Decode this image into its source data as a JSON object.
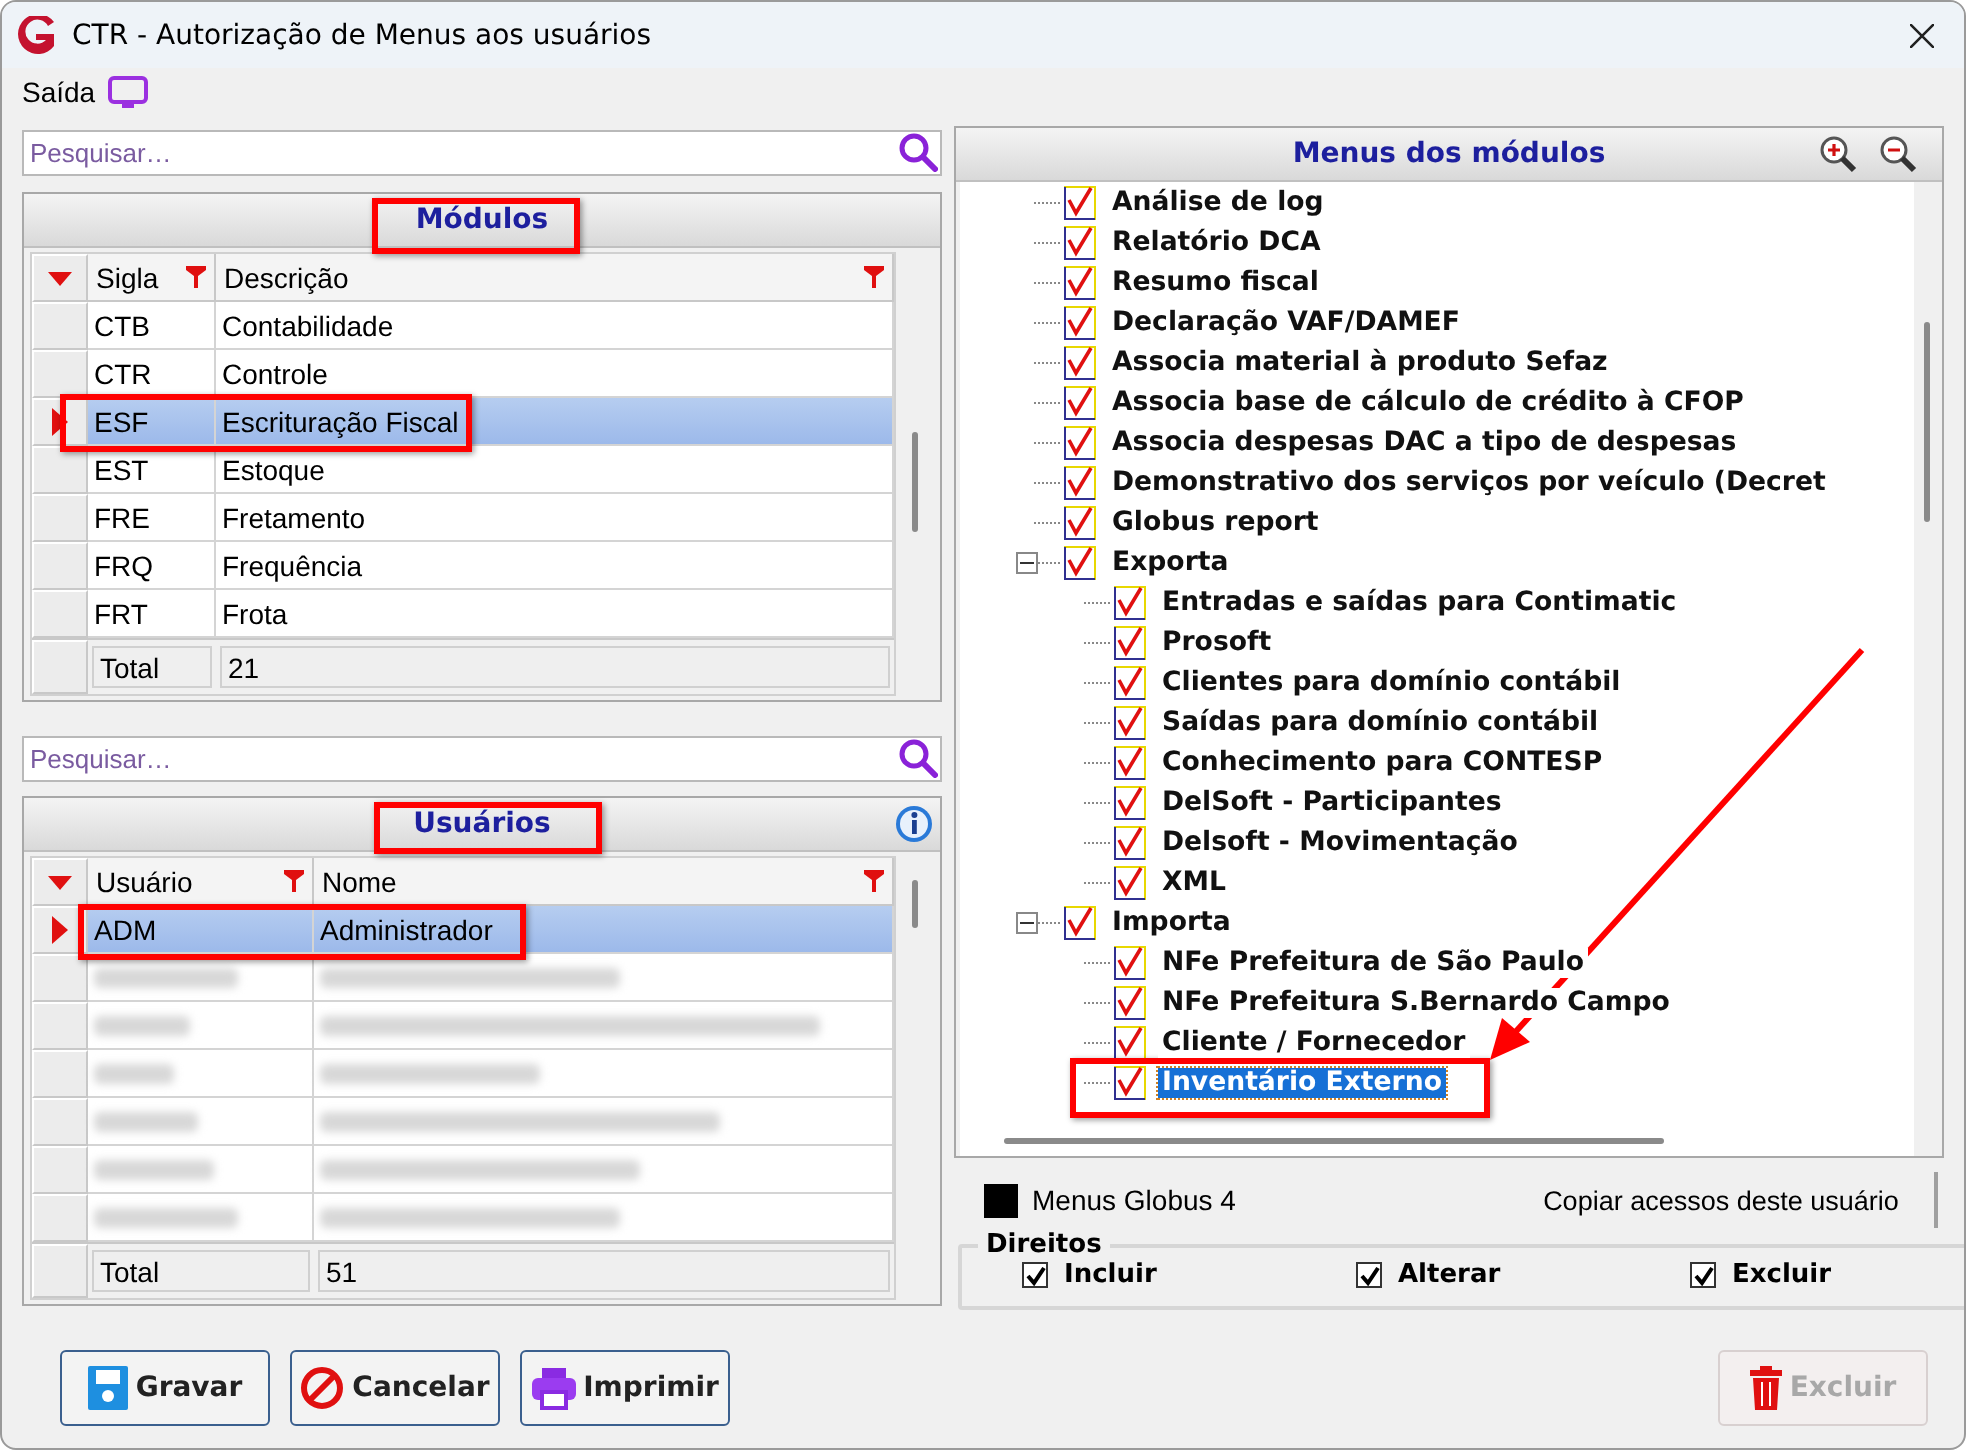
{
  "window": {
    "title": "CTR - Autorização de Menus aos usuários"
  },
  "menu": [
    {
      "label": "Saída"
    }
  ],
  "modules": {
    "search": {
      "placeholder": "Pesquisar…"
    },
    "title": "Módulos",
    "columns": [
      "Sigla",
      "Descrição"
    ],
    "rows": [
      {
        "cells": [
          "CTB",
          "Contabilidade"
        ],
        "selected": false
      },
      {
        "cells": [
          "CTR",
          "Controle"
        ],
        "selected": false
      },
      {
        "cells": [
          "ESF",
          "Escrituração Fiscal"
        ],
        "selected": true
      },
      {
        "cells": [
          "EST",
          "Estoque"
        ],
        "selected": false
      },
      {
        "cells": [
          "FRE",
          "Fretamento"
        ],
        "selected": false
      },
      {
        "cells": [
          "FRQ",
          "Frequência"
        ],
        "selected": false
      },
      {
        "cells": [
          "FRT",
          "Frota"
        ],
        "selected": false
      }
    ],
    "total": [
      "Total",
      "21"
    ]
  },
  "users": {
    "search": {
      "placeholder": "Pesquisar…"
    },
    "title": "Usuários",
    "columns": [
      "Usuário",
      "Nome"
    ],
    "rows": [
      {
        "cells": [
          "ADM",
          "Administrador"
        ],
        "selected": true
      }
    ],
    "total": [
      "Total",
      "51"
    ]
  },
  "menus": {
    "title": "Menus dos módulos",
    "items": [
      {
        "label": "Análise de log",
        "checked": true,
        "selected": false
      },
      {
        "label": "Relatório DCA",
        "checked": true,
        "selected": false
      },
      {
        "label": "Resumo fiscal",
        "checked": true,
        "selected": false
      },
      {
        "label": "Declaração VAF/DAMEF",
        "checked": true,
        "selected": false
      },
      {
        "label": "Associa material à produto Sefaz",
        "checked": true,
        "selected": false
      },
      {
        "label": "Associa base de cálculo de crédito à CFOP",
        "checked": true,
        "selected": false
      },
      {
        "label": "Associa despesas DAC a  tipo de despesas",
        "checked": true,
        "selected": false
      },
      {
        "label": "Demonstrativo dos serviços por veículo (Decret",
        "checked": true,
        "selected": false
      },
      {
        "label": "Globus report",
        "checked": true,
        "selected": false
      },
      {
        "label": "Exporta",
        "checked": true,
        "selected": false,
        "expanded": true,
        "children": [
          {
            "label": "Entradas e saídas para Contimatic",
            "checked": true,
            "selected": false
          },
          {
            "label": "Prosoft",
            "checked": true,
            "selected": false
          },
          {
            "label": "Clientes para domínio contábil",
            "checked": true,
            "selected": false
          },
          {
            "label": "Saídas para domínio contábil",
            "checked": true,
            "selected": false
          },
          {
            "label": "Conhecimento para CONTESP",
            "checked": true,
            "selected": false
          },
          {
            "label": "DelSoft - Participantes",
            "checked": true,
            "selected": false
          },
          {
            "label": "Delsoft - Movimentação",
            "checked": true,
            "selected": false
          },
          {
            "label": "XML",
            "checked": true,
            "selected": false
          }
        ]
      },
      {
        "label": "Importa",
        "checked": true,
        "selected": false,
        "expanded": true,
        "children": [
          {
            "label": "NFe Prefeitura de São Paulo",
            "checked": true,
            "selected": false
          },
          {
            "label": "NFe Prefeitura S.Bernardo Campo",
            "checked": true,
            "selected": false
          },
          {
            "label": "Cliente / Fornecedor",
            "checked": true,
            "selected": false
          },
          {
            "label": "Inventário Externo",
            "checked": true,
            "selected": true
          }
        ]
      }
    ]
  },
  "legend": {
    "label": "Menus Globus 4"
  },
  "copy_button": {
    "label": "Copiar acessos deste usuário"
  },
  "rights": {
    "title": "Direitos",
    "options": [
      {
        "label": "Incluir",
        "checked": true
      },
      {
        "label": "Alterar",
        "checked": true
      },
      {
        "label": "Excluir",
        "checked": true
      }
    ]
  },
  "buttons": [
    {
      "label": "Gravar",
      "kind": "save",
      "disabled": false
    },
    {
      "label": "Cancelar",
      "kind": "cancel",
      "disabled": false
    },
    {
      "label": "Imprimir",
      "kind": "print",
      "disabled": false
    },
    {
      "label": "Excluir",
      "kind": "delete",
      "disabled": true
    }
  ]
}
